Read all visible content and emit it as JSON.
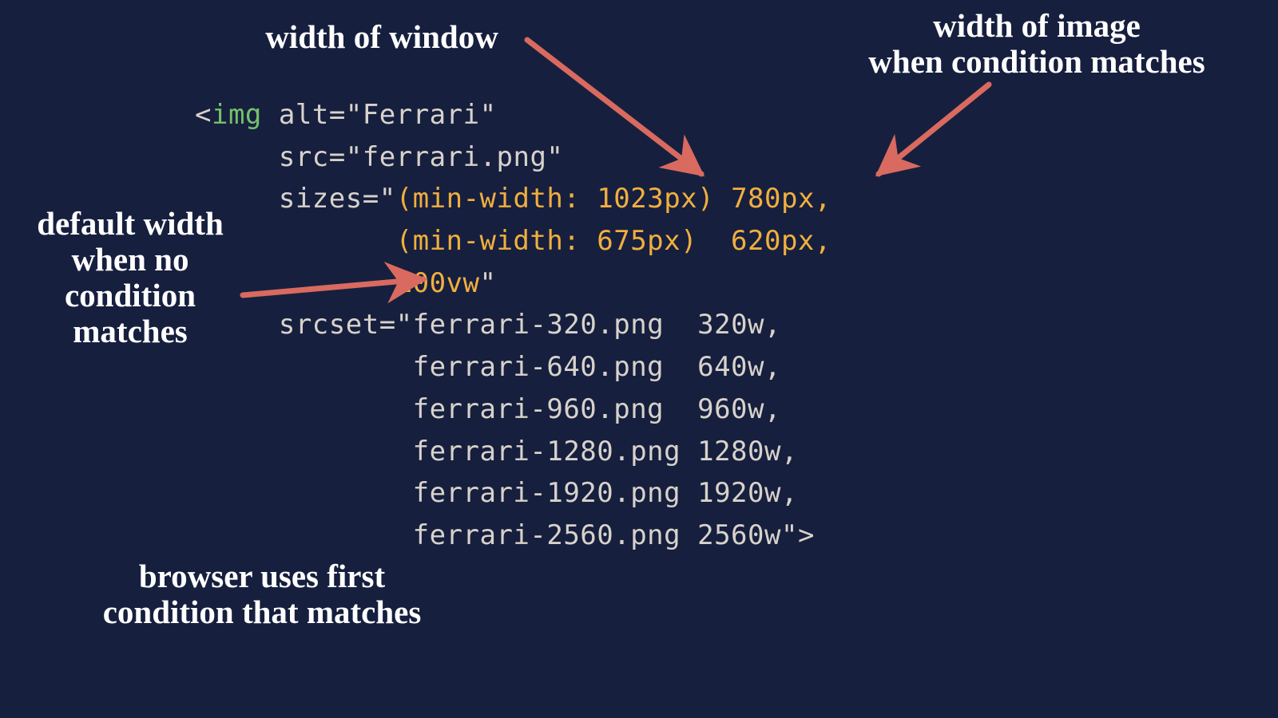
{
  "annotations": {
    "window_width": "width of window",
    "image_width": "width of image\nwhen condition matches",
    "default_width": "default width\nwhen no\ncondition\nmatches",
    "first_match": "browser uses first\ncondition that matches"
  },
  "code": {
    "tag_open": "<",
    "tag_name": "img",
    "alt_attr": "alt",
    "alt_val": "Ferrari",
    "src_attr": "src",
    "src_val": "ferrari.png",
    "sizes_attr": "sizes",
    "sizes_line1": "(min-width: 1023px) 780px,",
    "sizes_line2": "(min-width: 675px)  620px,",
    "sizes_line3": "100vw",
    "srcset_attr": "srcset",
    "srcset_1": "ferrari-320.png  320w,",
    "srcset_2": "ferrari-640.png  640w,",
    "srcset_3": "ferrari-960.png  960w,",
    "srcset_4": "ferrari-1280.png 1280w,",
    "srcset_5": "ferrari-1920.png 1920w,",
    "srcset_6": "ferrari-2560.png 2560w",
    "tag_close": ">"
  },
  "colors": {
    "bg": "#171f3e",
    "text": "#d7d2cb",
    "tag_green": "#73c26a",
    "highlight_gold": "#f0af3e",
    "arrow_red": "#d96a5f",
    "annot_white": "#ffffff"
  }
}
